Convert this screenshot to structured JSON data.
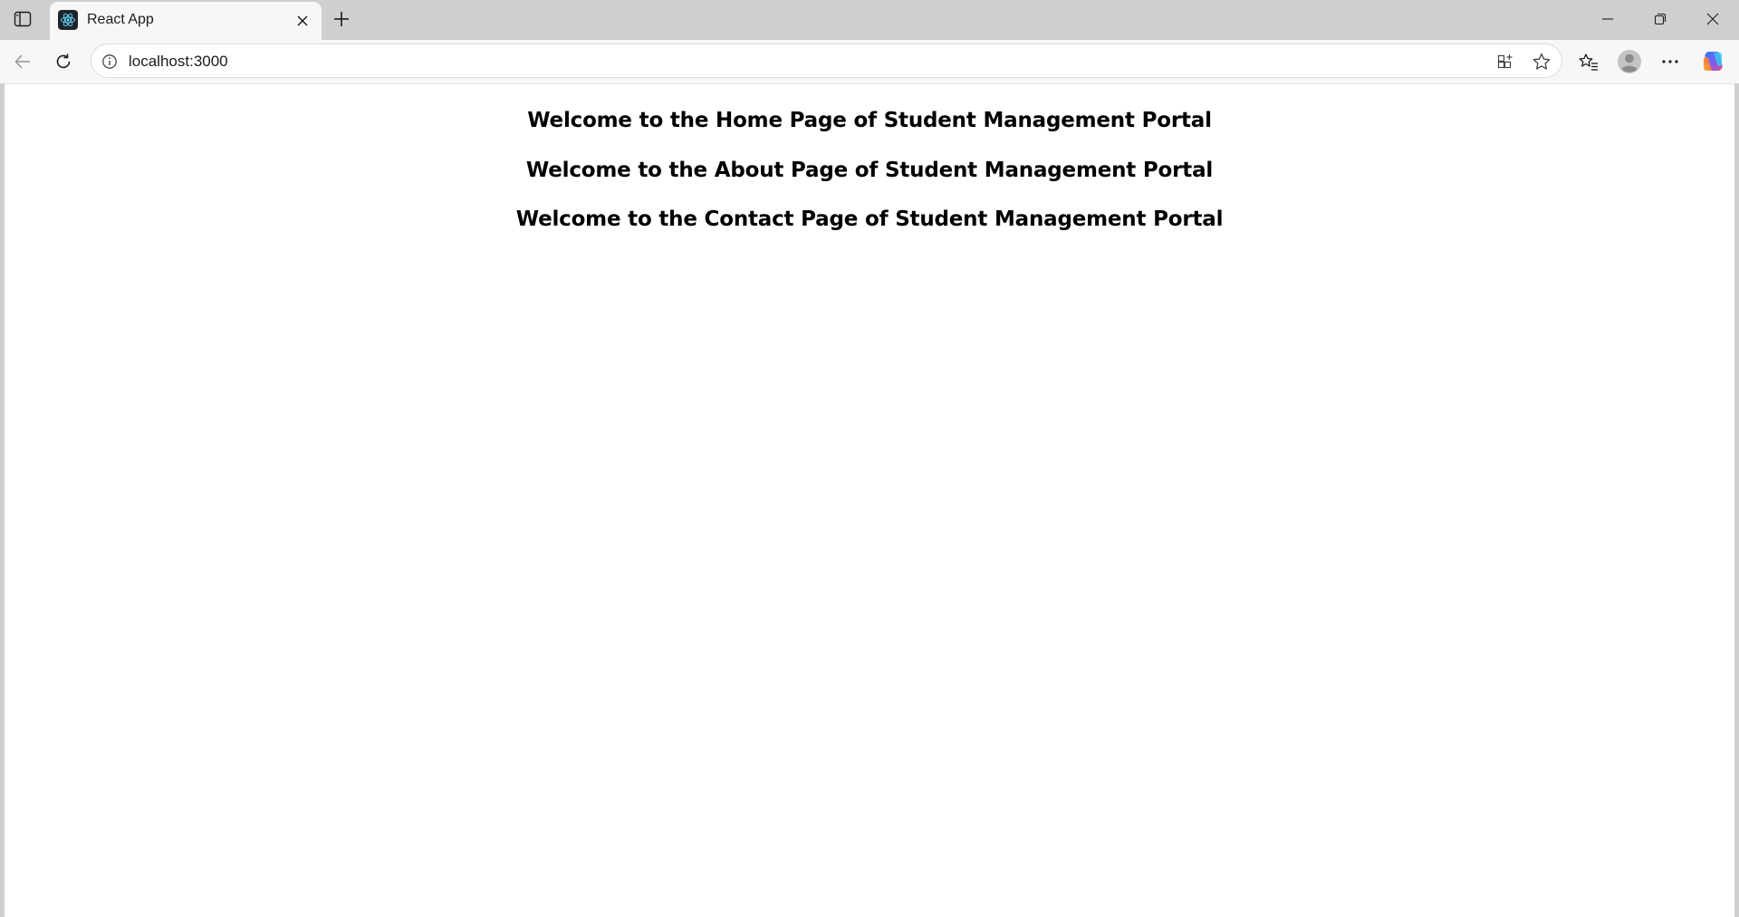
{
  "browser": {
    "tab": {
      "title": "React App"
    },
    "address": {
      "url": "localhost:3000"
    }
  },
  "page": {
    "headings": [
      "Welcome to the Home Page of Student Management Portal",
      "Welcome to the About Page of Student Management Portal",
      "Welcome to the Contact Page of Student Management Portal"
    ]
  },
  "icons": {
    "sidebar": "sidebar-toggle-icon",
    "favicon": "react-logo-icon",
    "close": "close-icon",
    "new_tab": "plus-icon",
    "back": "back-arrow-icon",
    "reload": "reload-icon",
    "site_info": "info-icon",
    "app": "app-available-icon",
    "favorite": "star-icon",
    "collections": "favorites-list-icon",
    "profile": "profile-avatar-icon",
    "more": "more-icon",
    "copilot": "copilot-icon"
  },
  "colors": {
    "chrome": "#cfcfcf",
    "toolbar": "#f7f7f7",
    "text": "#000000",
    "react_blue": "#61dafb"
  }
}
